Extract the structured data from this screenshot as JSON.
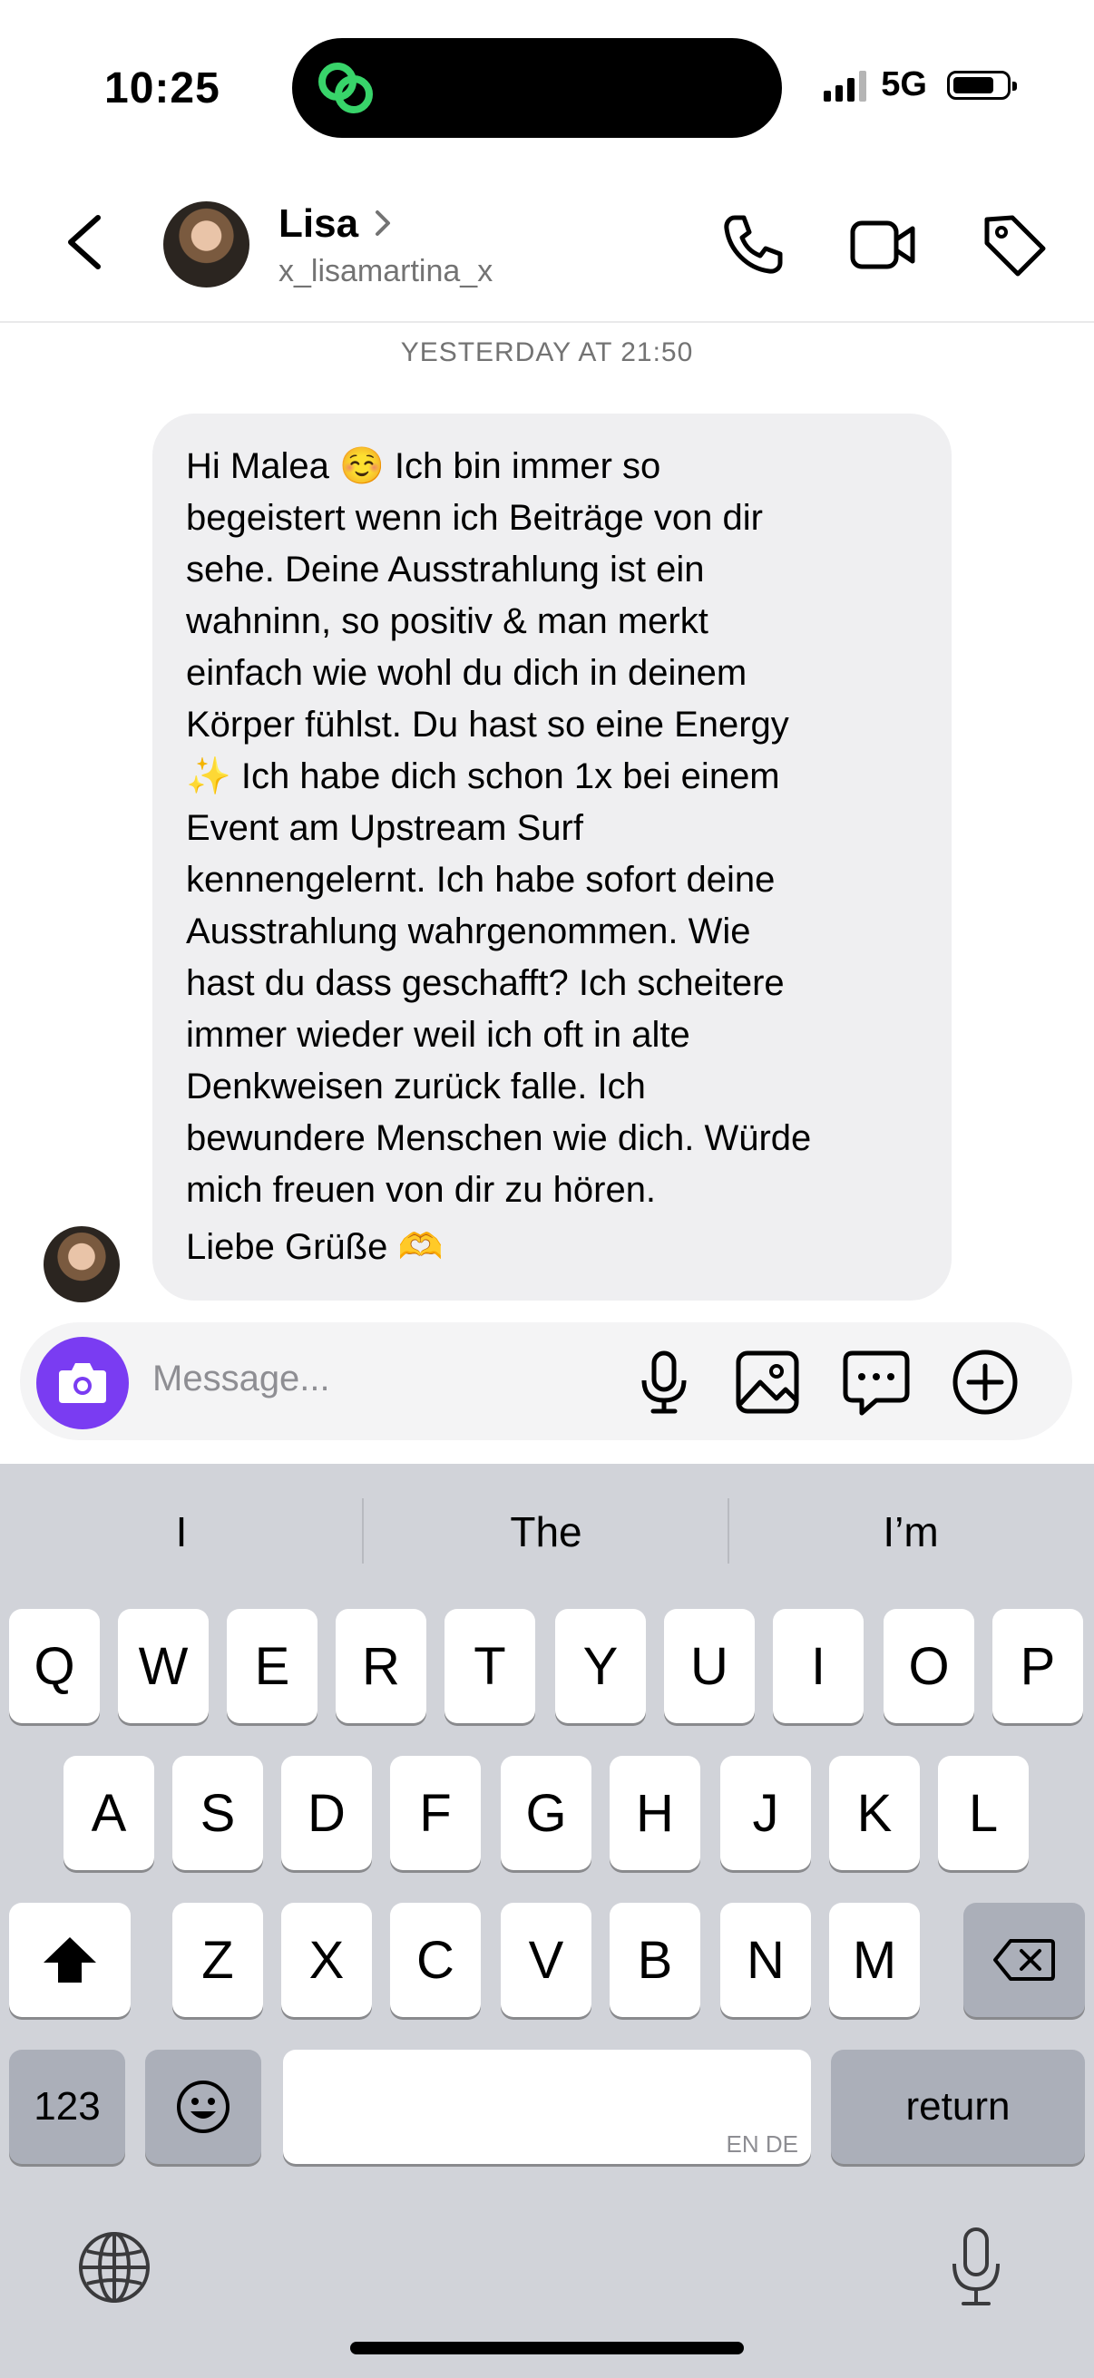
{
  "status_bar": {
    "time": "10:25",
    "network": "5G"
  },
  "header": {
    "contact_name": "Lisa",
    "contact_handle": "x_lisamartina_x",
    "icons": [
      "back-chevron-icon",
      "phone-icon",
      "video-camera-icon",
      "tag-icon"
    ]
  },
  "chat": {
    "timestamp": "YESTERDAY AT 21:50",
    "message": {
      "body": "Hi Malea ☺️ Ich bin immer so\nbegeistert wenn ich Beiträge von dir\nsehe. Deine Ausstrahlung ist ein\nwahninn, so positiv & man merkt\neinfach wie wohl du dich in deinem\nKörper fühlst. Du hast so eine Energy\n✨ Ich habe dich schon 1x bei einem\nEvent am Upstream Surf\nkennengelernt. Ich habe sofort deine\nAusstrahlung wahrgenommen. Wie\nhast du dass geschafft? Ich scheitere\nimmer wieder weil ich oft in alte\nDenkweisen zurück falle. Ich\nbewundere Menschen wie dich. Würde\nmich freuen von dir zu hören.",
      "signature": "Liebe Grüße 🫶"
    }
  },
  "composer": {
    "placeholder": "Message...",
    "accent_color": "#7a3cf2",
    "icons": [
      "camera-icon",
      "microphone-icon",
      "gallery-icon",
      "sticker-chat-icon",
      "plus-circle-icon"
    ]
  },
  "keyboard": {
    "suggestions": [
      "I",
      "The",
      "I’m"
    ],
    "row1": [
      "Q",
      "W",
      "E",
      "R",
      "T",
      "Y",
      "U",
      "I",
      "O",
      "P"
    ],
    "row2": [
      "A",
      "S",
      "D",
      "F",
      "G",
      "H",
      "J",
      "K",
      "L"
    ],
    "row3": [
      "Z",
      "X",
      "C",
      "V",
      "B",
      "N",
      "M"
    ],
    "numbers_label": "123",
    "return_label": "return",
    "space_hint": "EN DE"
  }
}
